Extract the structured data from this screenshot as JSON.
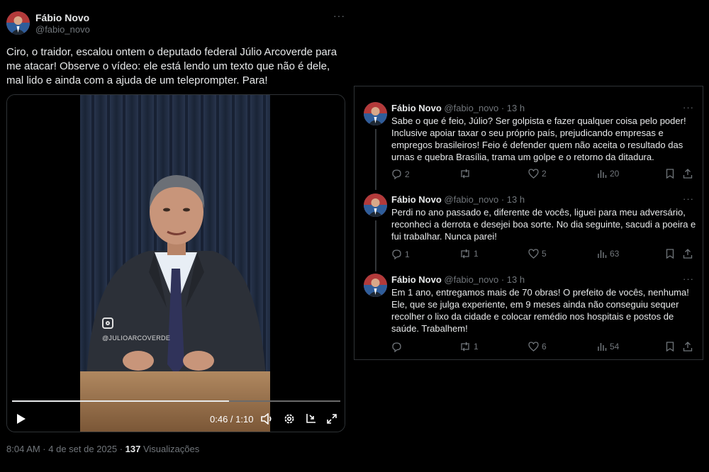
{
  "main_tweet": {
    "author_name": "Fábio Novo",
    "author_handle": "@fabio_novo",
    "more_label": "···",
    "text": "Ciro, o traidor, escalou ontem o deputado federal Júlio Arcoverde para me atacar! Observe o vídeo: ele está lendo um texto que não é dele, mal lido e ainda com a ajuda de um teleprompter. Para!",
    "video": {
      "watermark": "@JULIOARCOVERDE",
      "time": "0:46 / 1:10",
      "progress_fraction": 0.66,
      "controls": [
        "play-icon",
        "volume-icon",
        "settings-icon",
        "pip-icon",
        "fullscreen-icon"
      ]
    },
    "timestamp": "8:04 AM · 4 de set de 2025 · ",
    "views_count": "137",
    "views_label": " Visualizações"
  },
  "thread": {
    "replies": [
      {
        "name": "Fábio Novo",
        "handle": "@fabio_novo · 13 h",
        "more": "···",
        "text": "Sabe o que é feio, Júlio? Ser golpista e fazer qualquer coisa pelo poder! Inclusive apoiar taxar o seu próprio país, prejudicando empresas e empregos brasileiros! Feio é defender quem não aceita o resultado das urnas e quebra Brasília, trama um golpe e o retorno da ditadura.",
        "replies_count": "2",
        "reposts_count": "",
        "likes_count": "2",
        "views_count": "20"
      },
      {
        "name": "Fábio Novo",
        "handle": "@fabio_novo · 13 h",
        "more": "···",
        "text": "Perdi no ano passado e, diferente de vocês, liguei para meu adversário, reconheci a derrota e desejei boa sorte. No dia seguinte, sacudi a poeira e fui trabalhar. Nunca parei!",
        "replies_count": "1",
        "reposts_count": "1",
        "likes_count": "5",
        "views_count": "63"
      },
      {
        "name": "Fábio Novo",
        "handle": "@fabio_novo · 13 h",
        "more": "···",
        "text": "Em 1 ano, entregamos mais de 70 obras! O prefeito de vocês, nenhuma! Ele, que se julga experiente, em 9 meses ainda não conseguiu sequer recolher o lixo da cidade e colocar remédio nos hospitais e postos de saúde. Trabalhem!",
        "replies_count": "",
        "reposts_count": "1",
        "likes_count": "6",
        "views_count": "54"
      }
    ]
  },
  "colors": {
    "background": "#000000",
    "text_primary": "#e7e9ea",
    "text_secondary": "#71767b",
    "border": "#2f3336"
  }
}
